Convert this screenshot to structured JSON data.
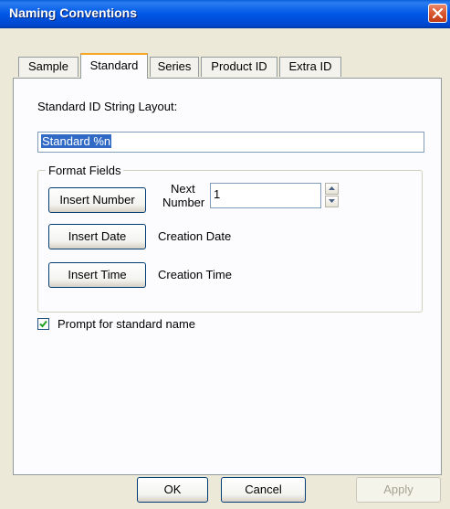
{
  "window": {
    "title": "Naming Conventions",
    "close_icon": "close-icon"
  },
  "tabs": [
    {
      "label": "Sample",
      "active": false
    },
    {
      "label": "Standard",
      "active": true
    },
    {
      "label": "Series",
      "active": false
    },
    {
      "label": "Product ID",
      "active": false
    },
    {
      "label": "Extra ID",
      "active": false
    }
  ],
  "panel": {
    "layout_label": "Standard ID String Layout:",
    "layout_value": "Standard %n",
    "format_group": {
      "title": "Format Fields",
      "insert_number": "Insert Number",
      "next_number_label_line1": "Next",
      "next_number_label_line2": "Number",
      "next_number_value": "1",
      "insert_date": "Insert Date",
      "creation_date": "Creation Date",
      "insert_time": "Insert Time",
      "creation_time": "Creation Time"
    },
    "prompt_checkbox": {
      "label": "Prompt for standard name",
      "checked": true
    }
  },
  "buttons": {
    "ok": "OK",
    "cancel": "Cancel",
    "apply": "Apply"
  }
}
